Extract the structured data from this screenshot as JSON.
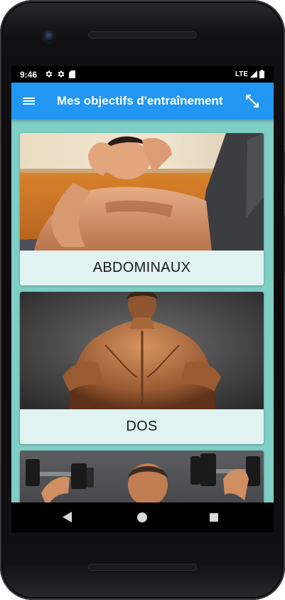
{
  "status_bar": {
    "time": "9:46",
    "network": "LTE",
    "icons": [
      "gear-icon",
      "gear-icon",
      "sd-card-icon",
      "signal-icon",
      "battery-icon"
    ]
  },
  "app_bar": {
    "title": "Mes objectifs d'entraînement",
    "color": "#2196f3",
    "menu_icon": "hamburger-menu-icon",
    "action_icon": "expand-arrows-icon"
  },
  "content": {
    "background": "#7fcfc6",
    "cards": [
      {
        "label": "ABDOMINAUX",
        "image": "man-doing-sit-ups-photo"
      },
      {
        "label": "DOS",
        "image": "muscular-back-photo"
      },
      {
        "label": "",
        "image": "man-lifting-dumbbells-photo"
      }
    ]
  },
  "nav_bar": {
    "icons": [
      "back-triangle-icon",
      "home-circle-icon",
      "recents-square-icon"
    ]
  }
}
